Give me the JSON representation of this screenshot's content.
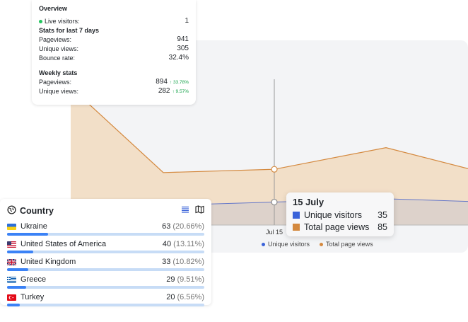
{
  "overview": {
    "title": "Overview",
    "live_label": "Live visitors:",
    "live_value": "1",
    "last7_title": "Stats for last 7 days",
    "pageviews_label": "Pageviews:",
    "pageviews_value": "941",
    "unique_label": "Unique views:",
    "unique_value": "305",
    "bounce_label": "Bounce rate:",
    "bounce_value": "32.4%",
    "weekly_title": "Weekly stats",
    "weekly_pageviews_label": "Pageviews:",
    "weekly_pageviews_value": "894",
    "weekly_pageviews_change": "↑ 33.78%",
    "weekly_unique_label": "Unique views:",
    "weekly_unique_value": "282",
    "weekly_unique_change": "↑ 9.57%"
  },
  "country_panel": {
    "title": "Country",
    "rows": [
      {
        "name": "Ukraine",
        "count": "63",
        "pct": "(20.66%)",
        "share": 20.66
      },
      {
        "name": "United States of America",
        "count": "40",
        "pct": "(13.11%)",
        "share": 13.11
      },
      {
        "name": "United Kingdom",
        "count": "33",
        "pct": "(10.82%)",
        "share": 10.82
      },
      {
        "name": "Greece",
        "count": "29",
        "pct": "(9.51%)",
        "share": 9.51
      },
      {
        "name": "Turkey",
        "count": "20",
        "pct": "(6.56%)",
        "share": 6.56
      }
    ]
  },
  "tooltip": {
    "date": "15 July",
    "unique_label": "Unique visitors",
    "unique_value": "35",
    "total_label": "Total page views",
    "total_value": "85"
  },
  "chart_data": {
    "type": "area",
    "x": [
      "",
      "",
      "Jul 15",
      "",
      ""
    ],
    "series": [
      {
        "name": "Unique visitors",
        "values": [
          null,
          30,
          35,
          40,
          36
        ]
      },
      {
        "name": "Total page views",
        "values": [
          210,
          80,
          85,
          118,
          86
        ]
      }
    ],
    "xlabel": "",
    "ylabel": "",
    "ylim": [
      0,
      260
    ],
    "legend": "bottom",
    "colors": {
      "Unique visitors": "#4f6fd1",
      "Total page views": "#d4893f"
    }
  },
  "legend": {
    "unique": "Unique visitors",
    "total": "Total page views"
  },
  "colors": {
    "green": "#22c55e",
    "blue": "#3b82f6",
    "orange": "#d4893f"
  }
}
